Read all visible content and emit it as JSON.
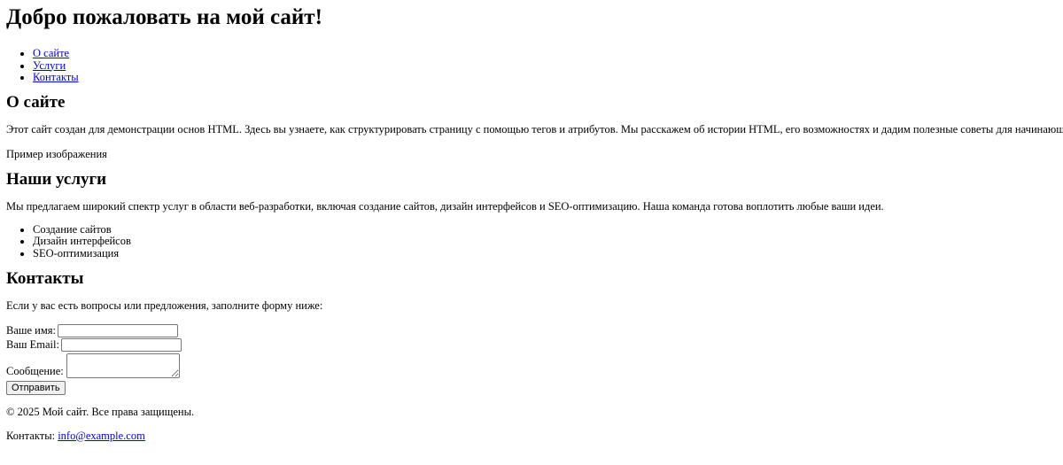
{
  "header": {
    "title": "Добро пожаловать на мой сайт!"
  },
  "nav": {
    "items": [
      {
        "label": "О сайте"
      },
      {
        "label": "Услуги"
      },
      {
        "label": "Контакты"
      }
    ]
  },
  "about": {
    "heading": "О сайте",
    "text": "Этот сайт создан для демонстрации основ HTML. Здесь вы узнаете, как структурировать страницу с помощью тегов и атрибутов. Мы расскажем об истории HTML, его возможностях и дадим полезные советы для начинающих.",
    "image_alt": "Пример изображения"
  },
  "services": {
    "heading": "Наши услуги",
    "text": "Мы предлагаем широкий спектр услуг в области веб-разработки, включая создание сайтов, дизайн интерфейсов и SEO-оптимизацию. Наша команда готова воплотить любые ваши идеи.",
    "items": [
      {
        "label": "Создание сайтов"
      },
      {
        "label": "Дизайн интерфейсов"
      },
      {
        "label": "SEO-оптимизация"
      }
    ]
  },
  "contacts": {
    "heading": "Контакты",
    "text": "Если у вас есть вопросы или предложения, заполните форму ниже:",
    "form": {
      "name_label": "Ваше имя:",
      "name_value": "",
      "email_label": "Ваш Email:",
      "email_value": "",
      "message_label": "Сообщение:",
      "message_value": "",
      "submit_label": "Отправить"
    }
  },
  "footer": {
    "copyright": "© 2025 Мой сайт. Все права защищены.",
    "contacts_label": "Контакты:",
    "email_link": "info@example.com"
  }
}
